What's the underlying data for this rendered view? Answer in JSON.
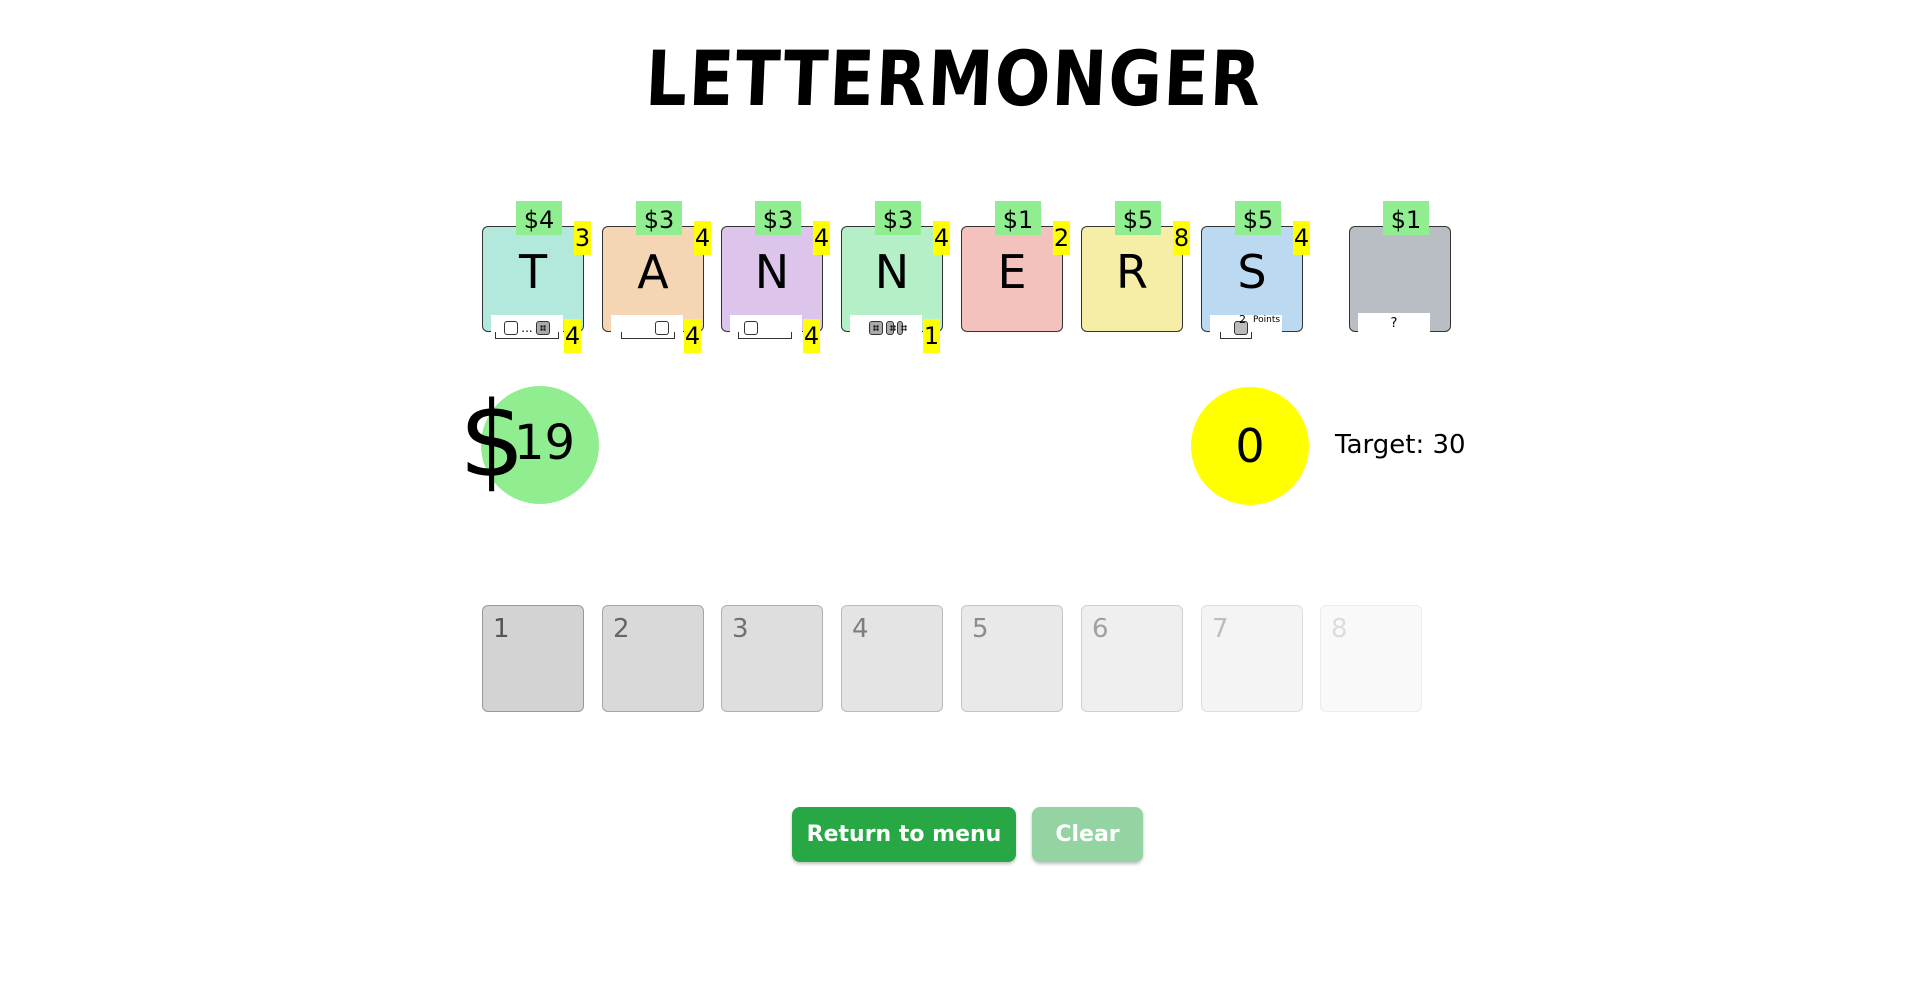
{
  "title": "LETTERMONGER",
  "colors": {
    "price_badge": "#90ee90",
    "points_badge": "#ffff00",
    "money_circle": "#90ee90",
    "score_circle": "#ffff00",
    "primary_button": "#28a745",
    "disabled_button": "#94d3a2"
  },
  "shop": [
    {
      "letter": "T",
      "price": "$4",
      "points": "3",
      "ability_count": "4",
      "color": "#b3e8dc",
      "ability_icon": "box-dots-dice-icon"
    },
    {
      "letter": "A",
      "price": "$3",
      "points": "4",
      "ability_count": "4",
      "color": "#f4d6b4",
      "ability_icon": "box-bracket-icon"
    },
    {
      "letter": "N",
      "price": "$3",
      "points": "4",
      "ability_count": "4",
      "color": "#dcc4ea",
      "ability_icon": "box-one-bracket-icon"
    },
    {
      "letter": "N",
      "price": "$3",
      "points": "4",
      "ability_count": "1",
      "color": "#b5efc8",
      "ability_icon": "dice-stack-icon"
    },
    {
      "letter": "E",
      "price": "$1",
      "points": "2",
      "ability_count": "",
      "color": "#f4c2bd",
      "ability_icon": ""
    },
    {
      "letter": "R",
      "price": "$5",
      "points": "8",
      "ability_count": "",
      "color": "#f6eea6",
      "ability_icon": ""
    },
    {
      "letter": "S",
      "price": "$5",
      "points": "4",
      "ability_count": "",
      "color": "#bcd9f2",
      "ability_icon": "box-two-points-icon",
      "ability_text": "2",
      "ability_label": "Points"
    },
    {
      "letter": "",
      "price": "$1",
      "points": "",
      "ability_count": "",
      "color": "#b9bec4",
      "ability_icon": "",
      "ability_text": "?"
    }
  ],
  "money": {
    "symbol": "$",
    "value": "19"
  },
  "score": {
    "value": "0",
    "target_label": "Target: 30"
  },
  "slots": [
    "1",
    "2",
    "3",
    "4",
    "5",
    "6",
    "7",
    "8"
  ],
  "buttons": {
    "return_label": "Return to menu",
    "clear_label": "Clear"
  }
}
